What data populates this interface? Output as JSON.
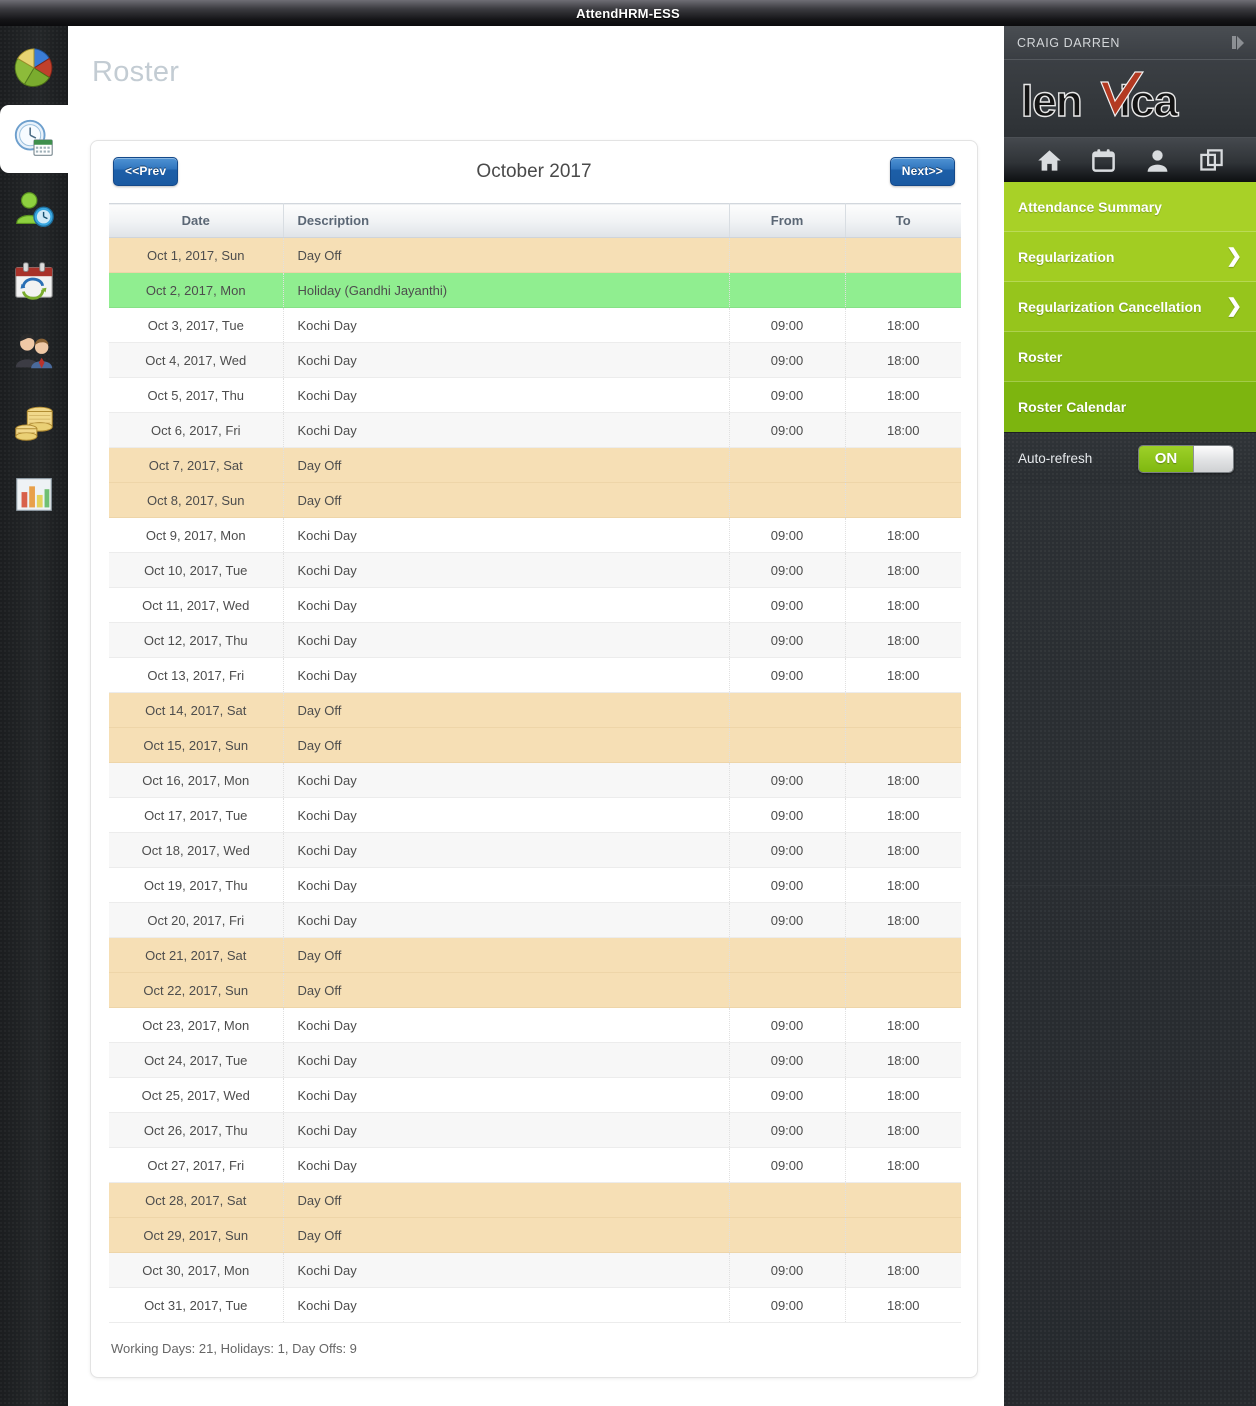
{
  "window": {
    "title": "AttendHRM-ESS"
  },
  "left_rail": {
    "items": [
      {
        "name": "dashboard-pie-icon",
        "icon": "pie-chart-icon",
        "active": false
      },
      {
        "name": "time-attendance-icon",
        "icon": "clock-calendar-icon",
        "active": true
      },
      {
        "name": "employee-time-icon",
        "icon": "person-clock-icon",
        "active": false
      },
      {
        "name": "leave-calendar-icon",
        "icon": "calendar-refresh-icon",
        "active": false
      },
      {
        "name": "employees-icon",
        "icon": "people-icon",
        "active": false
      },
      {
        "name": "payroll-icon",
        "icon": "coins-icon",
        "active": false
      },
      {
        "name": "reports-icon",
        "icon": "bar-chart-icon",
        "active": false
      }
    ]
  },
  "main": {
    "page_title": "Roster",
    "nav": {
      "prev_label": "<<Prev",
      "next_label": "Next>>"
    },
    "month_label": "October 2017",
    "table": {
      "columns": [
        "Date",
        "Description",
        "From",
        "To"
      ],
      "rows": [
        {
          "date": "Oct 1, 2017, Sun",
          "description": "Day Off",
          "from": "",
          "to": "",
          "type": "off"
        },
        {
          "date": "Oct 2, 2017, Mon",
          "description": "Holiday (Gandhi Jayanthi)",
          "from": "",
          "to": "",
          "type": "holiday"
        },
        {
          "date": "Oct 3, 2017, Tue",
          "description": "Kochi Day",
          "from": "09:00",
          "to": "18:00",
          "type": "work"
        },
        {
          "date": "Oct 4, 2017, Wed",
          "description": "Kochi Day",
          "from": "09:00",
          "to": "18:00",
          "type": "work"
        },
        {
          "date": "Oct 5, 2017, Thu",
          "description": "Kochi Day",
          "from": "09:00",
          "to": "18:00",
          "type": "work"
        },
        {
          "date": "Oct 6, 2017, Fri",
          "description": "Kochi Day",
          "from": "09:00",
          "to": "18:00",
          "type": "work"
        },
        {
          "date": "Oct 7, 2017, Sat",
          "description": "Day Off",
          "from": "",
          "to": "",
          "type": "off"
        },
        {
          "date": "Oct 8, 2017, Sun",
          "description": "Day Off",
          "from": "",
          "to": "",
          "type": "off"
        },
        {
          "date": "Oct 9, 2017, Mon",
          "description": "Kochi Day",
          "from": "09:00",
          "to": "18:00",
          "type": "work"
        },
        {
          "date": "Oct 10, 2017, Tue",
          "description": "Kochi Day",
          "from": "09:00",
          "to": "18:00",
          "type": "work"
        },
        {
          "date": "Oct 11, 2017, Wed",
          "description": "Kochi Day",
          "from": "09:00",
          "to": "18:00",
          "type": "work"
        },
        {
          "date": "Oct 12, 2017, Thu",
          "description": "Kochi Day",
          "from": "09:00",
          "to": "18:00",
          "type": "work"
        },
        {
          "date": "Oct 13, 2017, Fri",
          "description": "Kochi Day",
          "from": "09:00",
          "to": "18:00",
          "type": "work"
        },
        {
          "date": "Oct 14, 2017, Sat",
          "description": "Day Off",
          "from": "",
          "to": "",
          "type": "off"
        },
        {
          "date": "Oct 15, 2017, Sun",
          "description": "Day Off",
          "from": "",
          "to": "",
          "type": "off"
        },
        {
          "date": "Oct 16, 2017, Mon",
          "description": "Kochi Day",
          "from": "09:00",
          "to": "18:00",
          "type": "work"
        },
        {
          "date": "Oct 17, 2017, Tue",
          "description": "Kochi Day",
          "from": "09:00",
          "to": "18:00",
          "type": "work"
        },
        {
          "date": "Oct 18, 2017, Wed",
          "description": "Kochi Day",
          "from": "09:00",
          "to": "18:00",
          "type": "work"
        },
        {
          "date": "Oct 19, 2017, Thu",
          "description": "Kochi Day",
          "from": "09:00",
          "to": "18:00",
          "type": "work"
        },
        {
          "date": "Oct 20, 2017, Fri",
          "description": "Kochi Day",
          "from": "09:00",
          "to": "18:00",
          "type": "work"
        },
        {
          "date": "Oct 21, 2017, Sat",
          "description": "Day Off",
          "from": "",
          "to": "",
          "type": "off"
        },
        {
          "date": "Oct 22, 2017, Sun",
          "description": "Day Off",
          "from": "",
          "to": "",
          "type": "off"
        },
        {
          "date": "Oct 23, 2017, Mon",
          "description": "Kochi Day",
          "from": "09:00",
          "to": "18:00",
          "type": "work"
        },
        {
          "date": "Oct 24, 2017, Tue",
          "description": "Kochi Day",
          "from": "09:00",
          "to": "18:00",
          "type": "work"
        },
        {
          "date": "Oct 25, 2017, Wed",
          "description": "Kochi Day",
          "from": "09:00",
          "to": "18:00",
          "type": "work"
        },
        {
          "date": "Oct 26, 2017, Thu",
          "description": "Kochi Day",
          "from": "09:00",
          "to": "18:00",
          "type": "work"
        },
        {
          "date": "Oct 27, 2017, Fri",
          "description": "Kochi Day",
          "from": "09:00",
          "to": "18:00",
          "type": "work"
        },
        {
          "date": "Oct 28, 2017, Sat",
          "description": "Day Off",
          "from": "",
          "to": "",
          "type": "off"
        },
        {
          "date": "Oct 29, 2017, Sun",
          "description": "Day Off",
          "from": "",
          "to": "",
          "type": "off"
        },
        {
          "date": "Oct 30, 2017, Mon",
          "description": "Kochi Day",
          "from": "09:00",
          "to": "18:00",
          "type": "work"
        },
        {
          "date": "Oct 31, 2017, Tue",
          "description": "Kochi Day",
          "from": "09:00",
          "to": "18:00",
          "type": "work"
        }
      ]
    },
    "summary": "Working Days: 21, Holidays: 1, Day Offs: 9"
  },
  "right_panel": {
    "user_name": "CRAIG DARREN",
    "collapse_icon": "collapse-panel-icon",
    "logo_text": "lenVica",
    "top_icons": [
      {
        "name": "home-icon",
        "label": "Home"
      },
      {
        "name": "calendar-icon",
        "label": "Calendar"
      },
      {
        "name": "user-icon",
        "label": "Profile"
      },
      {
        "name": "windows-icon",
        "label": "Windows"
      }
    ],
    "menu": [
      {
        "label": "Attendance Summary",
        "chevron": ""
      },
      {
        "label": "Regularization",
        "chevron": "❯"
      },
      {
        "label": "Regularization Cancellation",
        "chevron": "❯"
      },
      {
        "label": "Roster",
        "chevron": ""
      },
      {
        "label": "Roster Calendar",
        "chevron": ""
      }
    ],
    "auto_refresh": {
      "label": "Auto-refresh",
      "state": "ON"
    }
  },
  "colors": {
    "accent_green": "#a8d127",
    "day_off": "#f6dfb5",
    "holiday": "#90ee90",
    "button_blue": "#2f74bd",
    "title_gray": "#c3ccd3"
  }
}
